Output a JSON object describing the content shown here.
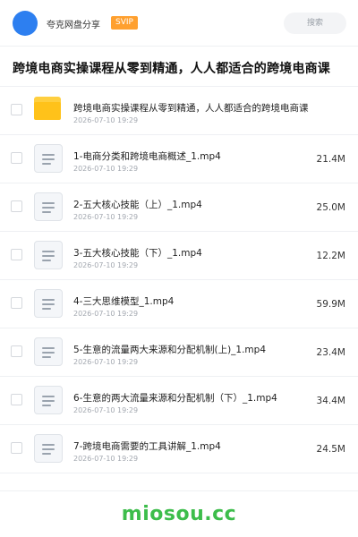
{
  "header": {
    "app_name": "夸克网盘分享",
    "badge": "SVIP",
    "search_placeholder": "搜索"
  },
  "page_title": "跨境电商实操课程从零到精通，人人都适合的跨境电商课",
  "files": [
    {
      "type": "folder",
      "name": "跨境电商实操课程从零到精通，人人都适合的跨境电商课",
      "date": "2026-07-10 19:29",
      "size": ""
    },
    {
      "type": "file",
      "name": "1-电商分类和跨境电商概述_1.mp4",
      "date": "2026-07-10 19:29",
      "size": "21.4M"
    },
    {
      "type": "file",
      "name": "2-五大核心技能（上）_1.mp4",
      "date": "2026-07-10 19:29",
      "size": "25.0M"
    },
    {
      "type": "file",
      "name": "3-五大核心技能（下）_1.mp4",
      "date": "2026-07-10 19:29",
      "size": "12.2M"
    },
    {
      "type": "file",
      "name": "4-三大思维模型_1.mp4",
      "date": "2026-07-10 19:29",
      "size": "59.9M"
    },
    {
      "type": "file",
      "name": "5-生意的流量两大来源和分配机制(上)_1.mp4",
      "date": "2026-07-10 19:29",
      "size": "23.4M"
    },
    {
      "type": "file",
      "name": "6-生意的两大流量来源和分配机制（下）_1.mp4",
      "date": "2026-07-10 19:29",
      "size": "34.4M"
    },
    {
      "type": "file",
      "name": "7-跨境电商需要的工具讲解_1.mp4",
      "date": "2026-07-10 19:29",
      "size": "24.5M"
    }
  ],
  "watermark": "miosou.cc",
  "colors": {
    "avatar": "#2d7ff0",
    "badge": "#ffa02f",
    "folder": "#ffc21a",
    "watermark": "#3dbd4b"
  }
}
